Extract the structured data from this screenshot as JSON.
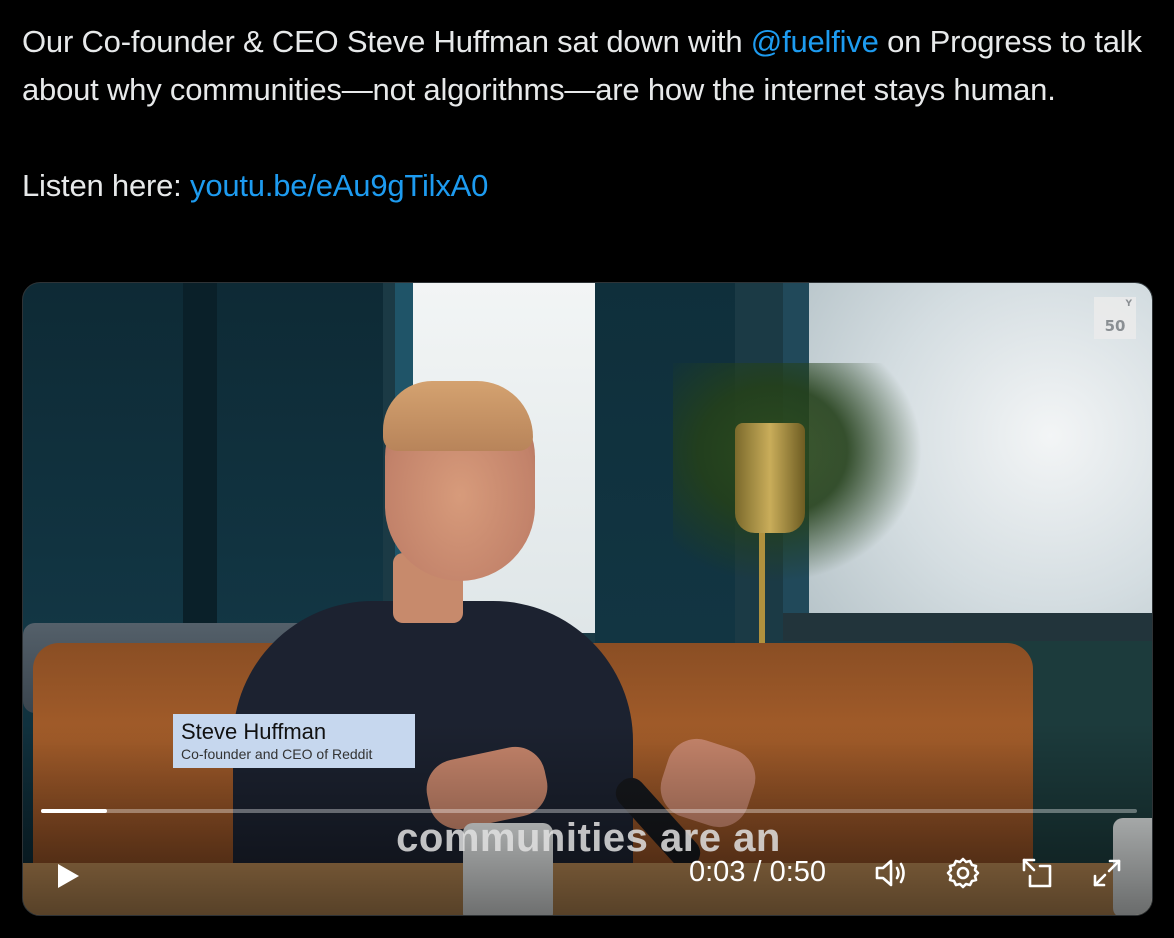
{
  "tweet": {
    "text_line1_before": "Our Co-founder & CEO Steve Huffman sat down with ",
    "mention": "@fuelfive",
    "text_line1_after": " on Progress to talk about why communities—not algorithms—are how the internet stays human.",
    "listen_label": "Listen here: ",
    "link": "youtu.be/eAu9gTilxA0"
  },
  "video": {
    "badge_number": "50",
    "badge_sup": "Y",
    "lower_third_name": "Steve Huffman",
    "lower_third_role": "Co-founder and CEO of Reddit",
    "caption": "communities are an",
    "current_time": "0:03",
    "duration": "0:50",
    "time_display": "0:03 / 0:50",
    "progress_fraction": 0.06
  },
  "icons": {
    "play": "play-icon",
    "volume": "volume-icon",
    "settings": "gear-icon",
    "pip": "picture-in-picture-icon",
    "fullscreen": "fullscreen-icon"
  },
  "colors": {
    "background": "#000000",
    "text": "#e7e9ea",
    "link": "#1d9bf0",
    "lower_third_bg": "#c6d7ee"
  }
}
